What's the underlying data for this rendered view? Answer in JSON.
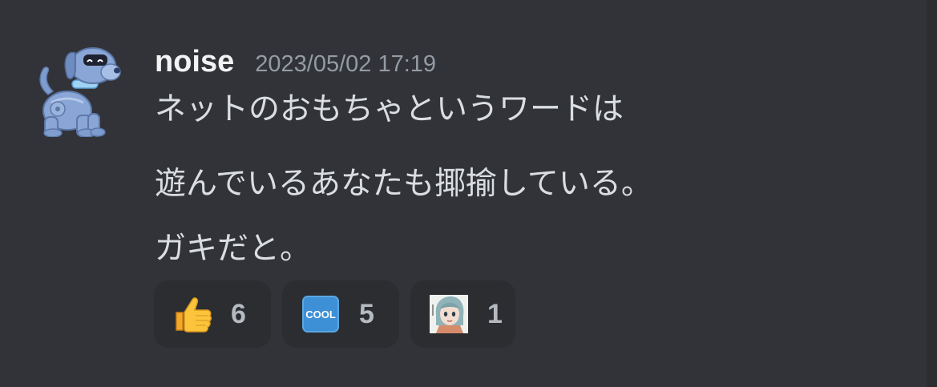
{
  "message": {
    "author": "noise",
    "timestamp": "2023/05/02 17:19",
    "lines": [
      "ネットのおもちゃというワードは",
      "遊んでいるあなたも揶揄している。",
      "ガキだと。"
    ]
  },
  "avatar": {
    "icon": "robot-dog-icon"
  },
  "reactions": [
    {
      "emoji": "thumbs-up-icon",
      "count": "6"
    },
    {
      "emoji": "cool-button-icon",
      "count": "5"
    },
    {
      "emoji": "custom-anime-girl-emoji",
      "count": "1"
    }
  ],
  "colors": {
    "background": "#313338",
    "reaction_bg": "#2b2d31",
    "username": "#f2f3f5",
    "timestamp": "#949ba4",
    "text": "#dbdee1",
    "count": "#b5bac1"
  }
}
